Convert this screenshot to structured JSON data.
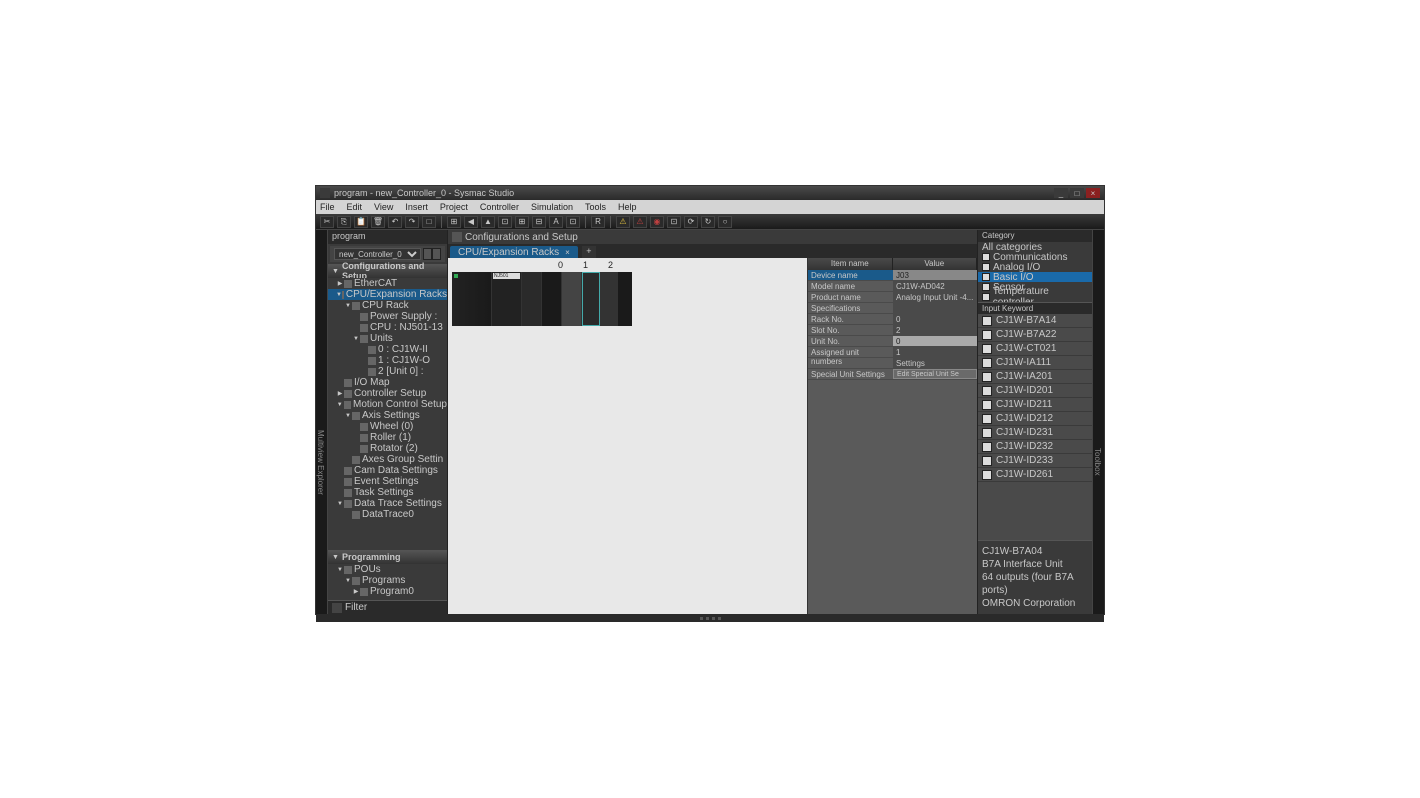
{
  "title": "program - new_Controller_0 - Sysmac Studio",
  "menu": [
    "File",
    "Edit",
    "View",
    "Insert",
    "Project",
    "Controller",
    "Simulation",
    "Tools",
    "Help"
  ],
  "left": {
    "label": "program",
    "vtab": "Multiview Explorer",
    "controller": "new_Controller_0",
    "sections": {
      "config": "Configurations and Setup",
      "programming": "Programming"
    },
    "tree": [
      {
        "d": 1,
        "t": "EtherCAT",
        "tw": "▶"
      },
      {
        "d": 1,
        "t": "CPU/Expansion Racks",
        "tw": "▼",
        "sel": true
      },
      {
        "d": 2,
        "t": "CPU Rack",
        "tw": "▼"
      },
      {
        "d": 3,
        "t": "Power Supply :"
      },
      {
        "d": 3,
        "t": "CPU : NJ501-13"
      },
      {
        "d": 3,
        "t": "Units",
        "tw": "▼"
      },
      {
        "d": 4,
        "t": "0 : CJ1W-II"
      },
      {
        "d": 4,
        "t": "1 : CJ1W-O"
      },
      {
        "d": 4,
        "t": "2 [Unit 0] :"
      },
      {
        "d": 1,
        "t": "I/O Map"
      },
      {
        "d": 1,
        "t": "Controller Setup",
        "tw": "▶"
      },
      {
        "d": 1,
        "t": "Motion Control Setup",
        "tw": "▼"
      },
      {
        "d": 2,
        "t": "Axis Settings",
        "tw": "▼"
      },
      {
        "d": 3,
        "t": "Wheel (0)"
      },
      {
        "d": 3,
        "t": "Roller (1)"
      },
      {
        "d": 3,
        "t": "Rotator (2)"
      },
      {
        "d": 2,
        "t": "Axes Group Settin"
      },
      {
        "d": 1,
        "t": "Cam Data Settings"
      },
      {
        "d": 1,
        "t": "Event Settings"
      },
      {
        "d": 1,
        "t": "Task Settings"
      },
      {
        "d": 1,
        "t": "Data Trace Settings",
        "tw": "▼"
      },
      {
        "d": 2,
        "t": "DataTrace0"
      }
    ],
    "ptree": [
      {
        "d": 1,
        "t": "POUs",
        "tw": "▼"
      },
      {
        "d": 2,
        "t": "Programs",
        "tw": "▼"
      },
      {
        "d": 3,
        "t": "Program0",
        "tw": "▶"
      }
    ],
    "filter": "Filter"
  },
  "center": {
    "header": "Configurations and Setup",
    "tab": "CPU/Expansion Racks",
    "slots": [
      "0",
      "1",
      "2"
    ]
  },
  "props": {
    "h1": "Item name",
    "h2": "Value",
    "rows": [
      {
        "k": "Device name",
        "v": "J03",
        "sel": true
      },
      {
        "k": "Model name",
        "v": "CJ1W-AD042"
      },
      {
        "k": "Product name",
        "v": "Analog Input Unit -4..."
      },
      {
        "k": "Specifications",
        "v": ""
      },
      {
        "k": "Rack No.",
        "v": "0"
      },
      {
        "k": "Slot No.",
        "v": "2"
      },
      {
        "k": "Unit No.",
        "v": "0",
        "ed": true
      },
      {
        "k": "Assigned unit numbers",
        "v": "1"
      },
      {
        "k": "",
        "v": "Settings"
      },
      {
        "k": "Special Unit Settings",
        "v": "Edit Special Unit Se",
        "btn": true
      }
    ]
  },
  "right": {
    "vtab": "Toolbox",
    "cathdr": "Category",
    "cats": [
      {
        "t": "All categories"
      },
      {
        "t": "Communications",
        "i": true
      },
      {
        "t": "Analog I/O",
        "i": true
      },
      {
        "t": "Basic I/O",
        "i": true,
        "sel": true
      },
      {
        "t": "Sensor",
        "i": true
      },
      {
        "t": "Temperature controller",
        "i": true
      }
    ],
    "kwhdr": "Input Keyword",
    "items": [
      "CJ1W-B7A14",
      "CJ1W-B7A22",
      "CJ1W-CT021",
      "CJ1W-IA111",
      "CJ1W-IA201",
      "CJ1W-ID201",
      "CJ1W-ID211",
      "CJ1W-ID212",
      "CJ1W-ID231",
      "CJ1W-ID232",
      "CJ1W-ID233",
      "CJ1W-ID261"
    ],
    "desc": {
      "name": "CJ1W-B7A04",
      "l1": "B7A Interface Unit",
      "l2": "64 outputs (four B7A ports)",
      "l3": "OMRON Corporation"
    }
  }
}
